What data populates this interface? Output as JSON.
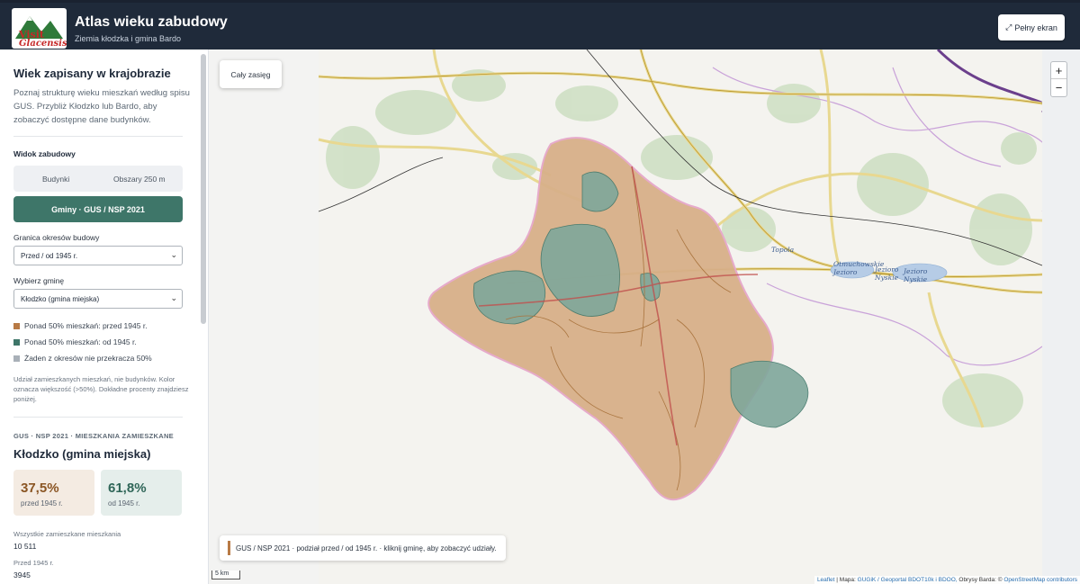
{
  "header": {
    "logo_text": "Visit Glacensis",
    "title": "Atlas wieku zabudowy",
    "subtitle": "Ziemia kłodzka i gmina Bardo",
    "fullscreen_label": "Pełny ekran"
  },
  "sidebar": {
    "heading": "Wiek zapisany w krajobrazie",
    "intro": "Poznaj strukturę wieku mieszkań według spisu GUS. Przybliż Kłodzko lub Bardo, aby zobaczyć dostępne dane budynków.",
    "view_section": "Widok zabudowy",
    "view_buttons": [
      "Budynki",
      "Obszary 250 m"
    ],
    "active_view": "Gminy · GUS / NSP 2021",
    "period_label": "Granica okresów budowy",
    "period_value": "Przed / od 1945 r.",
    "gmina_label": "Wybierz gminę",
    "gmina_value": "Kłodzko (gmina miejska)",
    "legend": [
      {
        "label": "Ponad 50% mieszkań: przed 1945 r.",
        "color": "#b87a45"
      },
      {
        "label": "Ponad 50% mieszkań: od 1945 r.",
        "color": "#3e7669"
      },
      {
        "label": "Żaden z okresów nie przekracza 50%",
        "color": "#a9b0b8"
      }
    ],
    "note": "Udział zamieszkanych mieszkań, nie budynków. Kolor oznacza większość (>50%). Dokładne procenty znajdziesz poniżej.",
    "stats_kicker": "GUS · NSP 2021 · MIESZKANIA ZAMIESZKANE",
    "stats_title": "Kłodzko (gmina miejska)",
    "card_before": {
      "value": "37,5%",
      "label": "przed 1945 r."
    },
    "card_after": {
      "value": "61,8%",
      "label": "od 1945 r."
    },
    "total_label": "Wszystkie zamieszkane mieszkania",
    "total_value": "10 511",
    "before_label": "Przed 1945 r.",
    "before_value": "3945"
  },
  "map": {
    "full_extent": "Cały zasięg",
    "zoom_in": "+",
    "zoom_out": "−",
    "info": "GUS / NSP 2021 · podział przed / od 1945 r. · kliknij gminę, aby zobaczyć udziały.",
    "scale": "5 km",
    "places": [
      "Topola",
      "Otmuchowskie Jezioro",
      "Jezioro Nyskie",
      "Jezioro Nyskie"
    ],
    "attribution": {
      "leaflet": "Leaflet",
      "mapa": "| Mapa:",
      "gugik": "GUGiK / Geoportal",
      "bdot": "BDOT10k i BDOO,",
      "obrysy": "Obrysy Barda: ©",
      "osm": "OpenStreetMap contributors"
    }
  }
}
